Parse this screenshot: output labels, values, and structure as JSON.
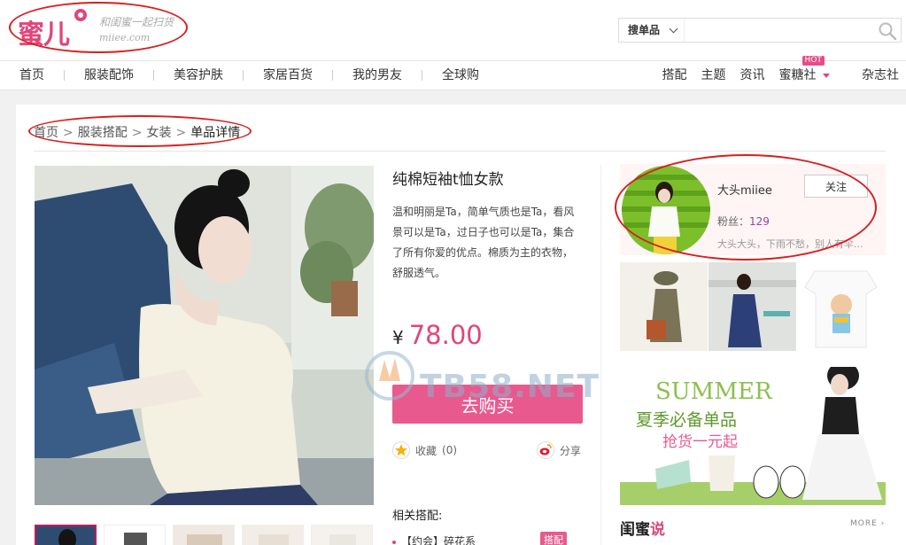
{
  "logo": {
    "text": "蜜儿",
    "slogan": "和闺蜜一起扫货",
    "domain": "miiee.com"
  },
  "search": {
    "type_label": "搜单品",
    "placeholder": ""
  },
  "nav": {
    "left": [
      "首页",
      "服装配饰",
      "美容护肤",
      "家居百货",
      "我的男友",
      "全球购"
    ],
    "right": [
      "搭配",
      "主题",
      "资讯",
      "蜜糖社",
      "杂志社"
    ],
    "hot_badge": "HOT"
  },
  "breadcrumb": [
    "首页",
    "服装搭配",
    "女装",
    "单品详情"
  ],
  "product": {
    "title": "纯棉短袖t恤女款",
    "description": "温和明丽是Ta，简单气质也是Ta，看风景可以是Ta，过日子也可以是Ta，集合了所有你爱的优点。棉质为主的衣物，舒服透气。",
    "currency": "¥",
    "price": "78.00",
    "buy_label": "去购买",
    "fav_label": "收藏",
    "fav_count": "(0)",
    "share_label": "分享",
    "related_title": "相关搭配:",
    "related_item": "【约会】碎花系",
    "related_badge": "搭配"
  },
  "user": {
    "name": "大头miiee",
    "follow_label": "关注",
    "fans_label": "粉丝：",
    "fans_count": "129",
    "bio": "大头大头，下雨不愁，别人有伞..."
  },
  "banner": {
    "title": "SUMMER",
    "line1": "夏季必备单品",
    "line2": "抢货一元起"
  },
  "section": {
    "title_a": "闺蜜",
    "title_b": "说",
    "more": "MORE"
  },
  "watermark": "TB58.NET",
  "colors": {
    "accent": "#e0457b",
    "button": "#e85a8e",
    "annotation": "#d81e1e"
  }
}
